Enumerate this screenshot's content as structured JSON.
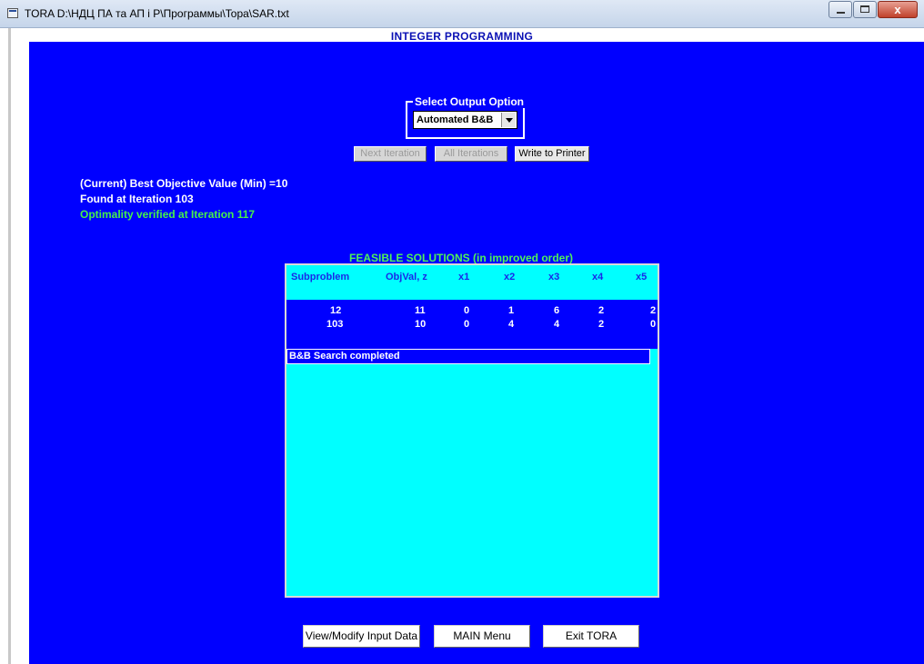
{
  "window": {
    "title": "TORA  D:\\НДЦ ПА та АП і Р\\Программы\\Topa\\SAR.txt",
    "close_glyph": "x"
  },
  "app_title": "INTEGER PROGRAMMING",
  "output_option": {
    "legend": "Select Output Option",
    "selected": "Automated B&B"
  },
  "iteration_buttons": {
    "next": "Next Iteration",
    "all": "All Iterations",
    "print": "Write to Printer"
  },
  "info": {
    "best_objective": "(Current) Best Objective Value (Min) =10",
    "found_at": "Found at Iteration 103",
    "optimality": "Optimality verified at Iteration 117"
  },
  "feasible": {
    "title": "FEASIBLE SOLUTIONS (in improved order)",
    "columns": [
      "Subproblem",
      "ObjVal, z",
      "x1",
      "x2",
      "x3",
      "x4",
      "x5"
    ],
    "rows": [
      [
        "12",
        "11",
        "0",
        "1",
        "6",
        "2",
        "2"
      ],
      [
        "103",
        "10",
        "0",
        "4",
        "4",
        "2",
        "0"
      ]
    ],
    "status": "B&B Search completed"
  },
  "bottom_buttons": {
    "view_modify": "View/Modify Input Data",
    "main_menu": "MAIN Menu",
    "exit": "Exit TORA"
  },
  "colors": {
    "panel": "#0000ff",
    "table_bg": "#00ffff",
    "highlight_green": "#46f04a"
  }
}
